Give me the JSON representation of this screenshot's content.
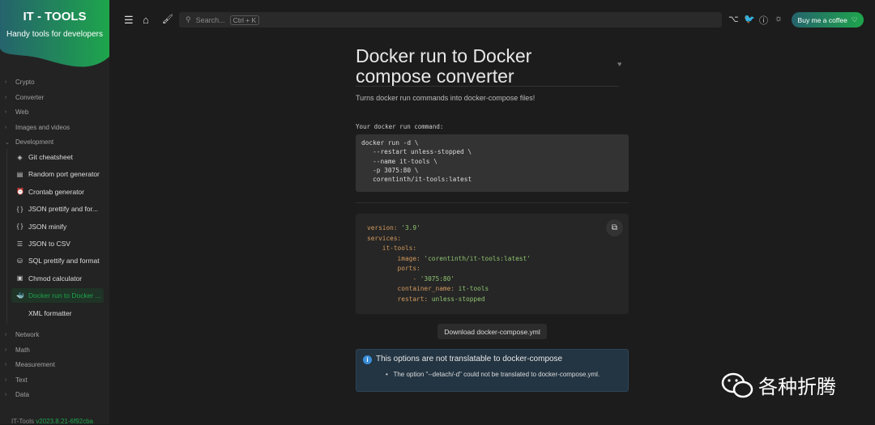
{
  "app": {
    "title": "IT - TOOLS",
    "subtitle": "Handy tools for developers",
    "footer_name": "IT-Tools",
    "footer_version": "v2023.8.21-6f92cba"
  },
  "sidebar": {
    "categories_top": [
      "Crypto",
      "Converter",
      "Web",
      "Images and videos",
      "Development"
    ],
    "dev_items": [
      {
        "label": "Git cheatsheet",
        "icon": "git-icon"
      },
      {
        "label": "Random port generator",
        "icon": "server-icon"
      },
      {
        "label": "Crontab generator",
        "icon": "alarm-icon"
      },
      {
        "label": "JSON prettify and for...",
        "icon": "braces-icon"
      },
      {
        "label": "JSON minify",
        "icon": "braces-icon"
      },
      {
        "label": "JSON to CSV",
        "icon": "list-icon"
      },
      {
        "label": "SQL prettify and format",
        "icon": "database-icon"
      },
      {
        "label": "Chmod calculator",
        "icon": "file-icon"
      },
      {
        "label": "Docker run to Docker ...",
        "icon": "docker-icon",
        "active": true
      },
      {
        "label": "XML formatter",
        "icon": "code-icon"
      }
    ],
    "categories_bottom": [
      "Network",
      "Math",
      "Measurement",
      "Text",
      "Data"
    ]
  },
  "header": {
    "search_placeholder": "Search...",
    "shortcut": "Ctrl + K",
    "coffee": "Buy me a coffee"
  },
  "tool": {
    "title": "Docker run to Docker compose converter",
    "description": "Turns docker run commands into docker-compose files!",
    "input_label": "Your docker run command:",
    "input_value": "docker run -d \\\n   --restart unless-stopped \\\n   --name it-tools \\\n   -p 3075:80 \\\n   corentinth/it-tools:latest",
    "yaml": [
      {
        "k": "version: ",
        "v": "'3.9'"
      },
      {
        "k": "services:",
        "v": ""
      },
      {
        "k": "    it-tools:",
        "v": ""
      },
      {
        "k": "        image: ",
        "v": "'corentinth/it-tools:latest'"
      },
      {
        "k": "        ports:",
        "v": ""
      },
      {
        "k": "            - ",
        "v": "'3075:80'"
      },
      {
        "k": "        container_name: ",
        "v": "it-tools"
      },
      {
        "k": "        restart: ",
        "v": "unless-stopped"
      }
    ],
    "download": "Download docker-compose.yml",
    "alert_title": "This options are not translatable to docker-compose",
    "alert_item": "The option \"--detach/-d\" could not be translated to docker-compose.yml."
  },
  "watermark": "各种折腾",
  "colors": {
    "accent": "#1ea54c",
    "alert_bg": "#233442",
    "yaml_key": "#d39a5e",
    "yaml_value": "#8fc470"
  }
}
